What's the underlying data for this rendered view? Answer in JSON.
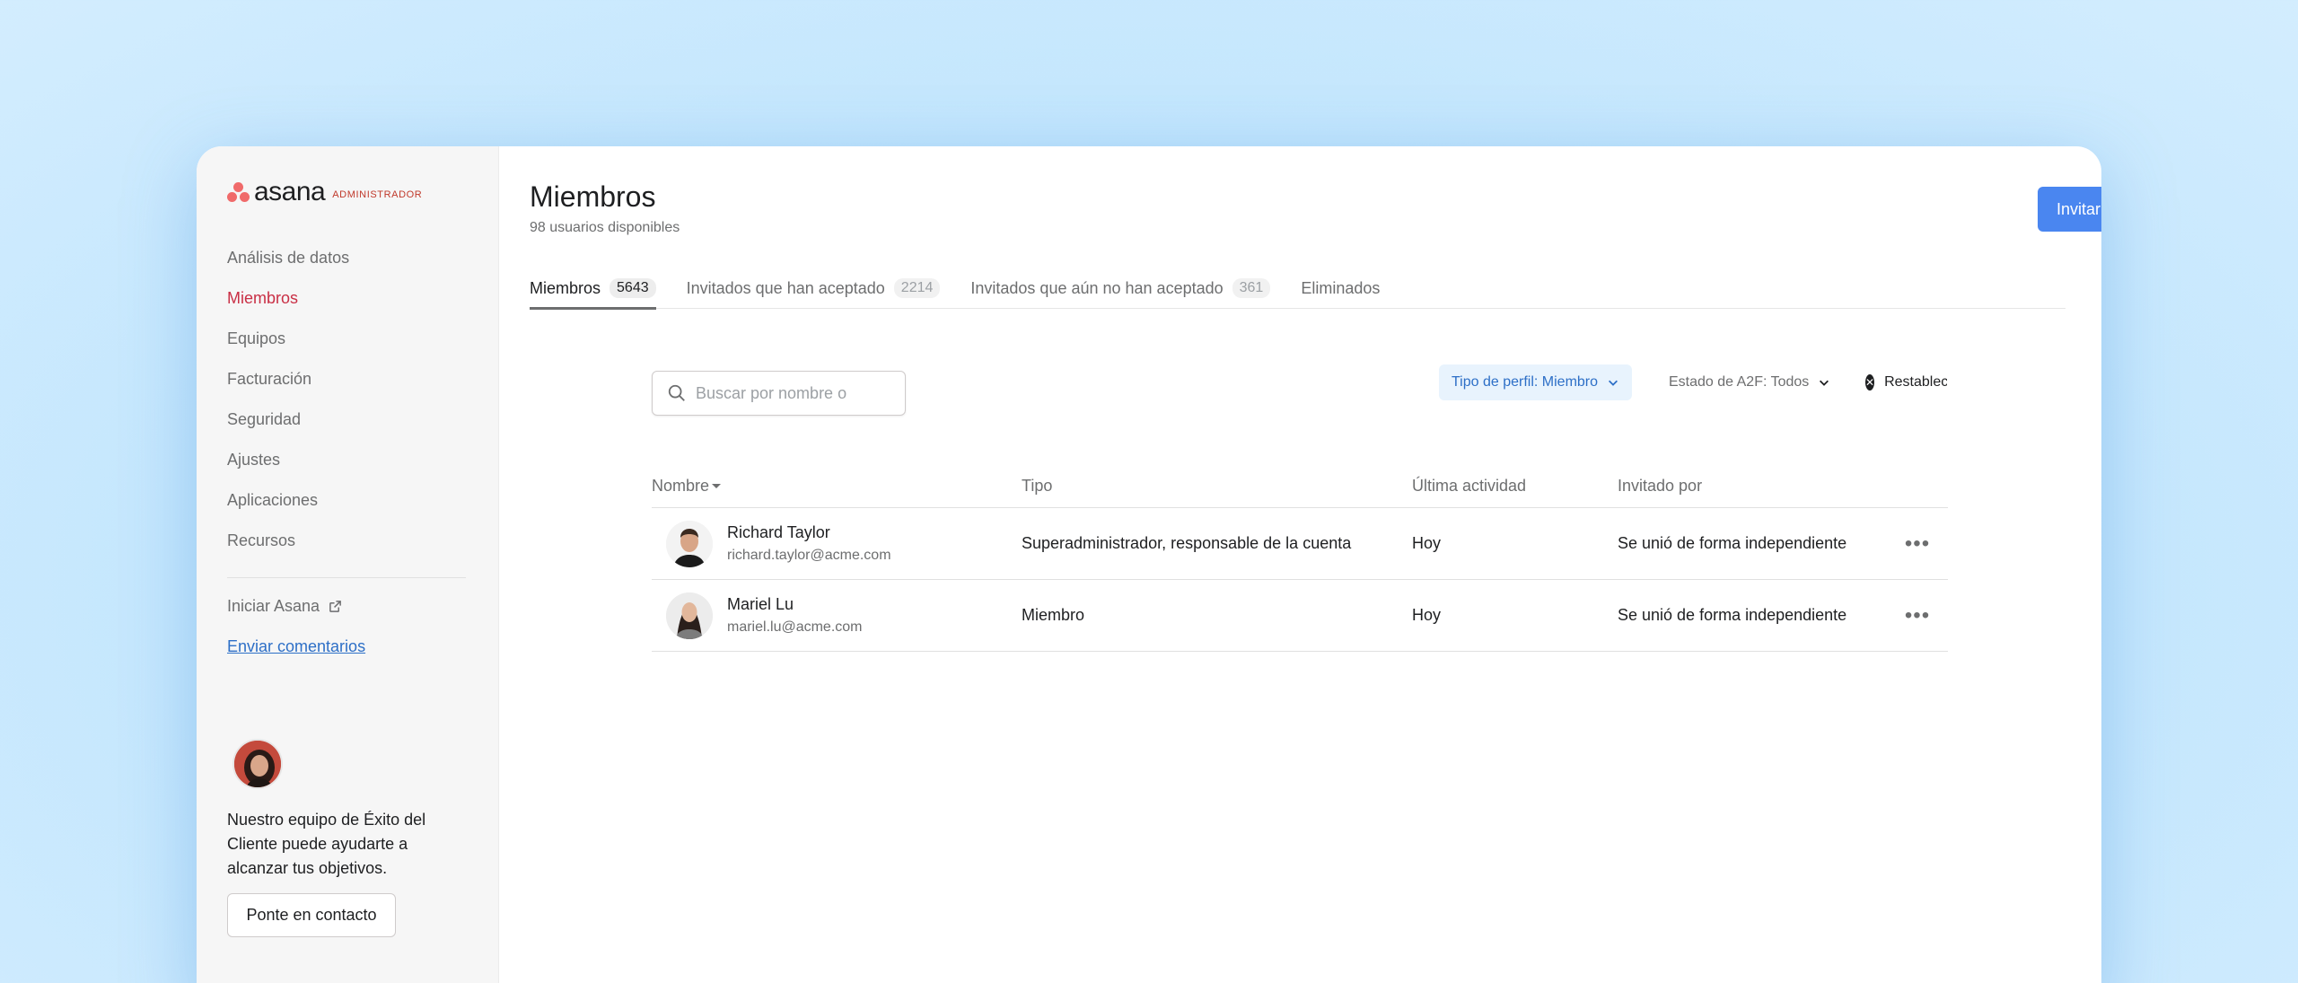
{
  "app": {
    "logo_text": "asana",
    "logo_badge": "ADMINISTRADOR"
  },
  "sidebar": {
    "items": [
      {
        "label": "Análisis de datos",
        "active": false
      },
      {
        "label": "Miembros",
        "active": true
      },
      {
        "label": "Equipos",
        "active": false
      },
      {
        "label": "Facturación",
        "active": false
      },
      {
        "label": "Seguridad",
        "active": false
      },
      {
        "label": "Ajustes",
        "active": false
      },
      {
        "label": "Aplicaciones",
        "active": false
      },
      {
        "label": "Recursos",
        "active": false
      }
    ],
    "launch_label": "Iniciar Asana",
    "feedback_label": "Enviar comentarios",
    "help_text": "Nuestro equipo de Éxito del Cliente puede ayudarte a alcanzar tus objetivos.",
    "contact_button": "Ponte en contacto"
  },
  "header": {
    "title": "Miembros",
    "subtitle": "98 usuarios disponibles",
    "invite_button": "Invitar a miembros"
  },
  "tabs": [
    {
      "label": "Miembros",
      "count": "5643",
      "active": true
    },
    {
      "label": "Invitados que han aceptado",
      "count": "2214",
      "active": false
    },
    {
      "label": "Invitados que aún no han aceptado",
      "count": "361",
      "active": false
    },
    {
      "label": "Eliminados",
      "count": "",
      "active": false
    }
  ],
  "search": {
    "placeholder": "Buscar por nombre o"
  },
  "filters": {
    "profile_type": "Tipo de perfil: Miembro",
    "twofa_state": "Estado de A2F: Todos",
    "reset_label": "Restablecer"
  },
  "table": {
    "columns": {
      "name": "Nombre",
      "type": "Tipo",
      "last_activity": "Última actividad",
      "invited_by": "Invitado por"
    },
    "rows": [
      {
        "name": "Richard Taylor",
        "email": "richard.taylor@acme.com",
        "type": "Superadministrador, responsable de la cuenta",
        "last_activity": "Hoy",
        "invited_by": "Se unió de forma independiente"
      },
      {
        "name": "Mariel Lu",
        "email": "mariel.lu@acme.com",
        "type": "Miembro",
        "last_activity": "Hoy",
        "invited_by": "Se unió de forma independiente"
      }
    ]
  },
  "colors": {
    "brand": "#f06a6a",
    "accent": "#4a86f0",
    "active_nav": "#c92f45",
    "link": "#2d6fc7"
  }
}
